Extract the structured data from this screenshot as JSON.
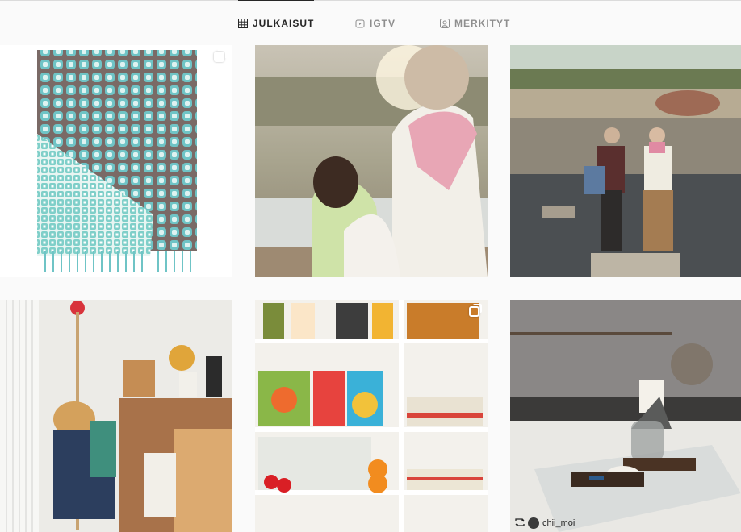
{
  "tabs": [
    {
      "label": "JULKAISUT",
      "icon": "grid-icon",
      "active": true
    },
    {
      "label": "IGTV",
      "icon": "igtv-icon",
      "active": false
    },
    {
      "label": "MERKITYT",
      "icon": "tagged-icon",
      "active": false
    }
  ],
  "posts": [
    {
      "subject": "blanket",
      "multi": true
    },
    {
      "subject": "mother-child",
      "multi": false
    },
    {
      "subject": "couple-river",
      "multi": false
    },
    {
      "subject": "coat-rack",
      "multi": false
    },
    {
      "subject": "bookshelf",
      "multi": true
    },
    {
      "subject": "coffee-kitchen",
      "multi": false,
      "repost_user": "chii_moi"
    }
  ],
  "colors": {
    "accent": "#262626",
    "muted": "#8e8e8e",
    "divider": "#dbdbdb"
  }
}
